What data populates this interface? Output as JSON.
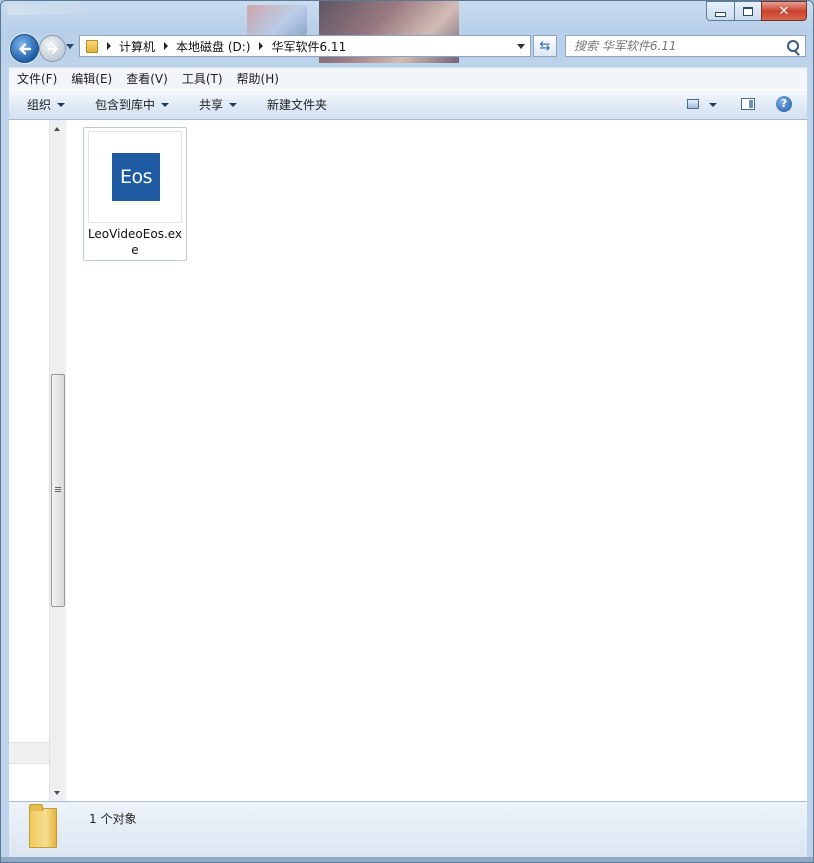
{
  "window": {
    "controls": {
      "minimize": "minimize",
      "maximize": "maximize",
      "close": "close"
    }
  },
  "navigation": {
    "breadcrumb": [
      "计算机",
      "本地磁盘 (D:)",
      "华军软件6.11"
    ],
    "search_placeholder": "搜索 华军软件6.11"
  },
  "menubar": {
    "items": [
      "文件(F)",
      "编辑(E)",
      "查看(V)",
      "工具(T)",
      "帮助(H)"
    ]
  },
  "toolbar": {
    "organize": "组织",
    "include_in_library": "包含到库中",
    "share": "共享",
    "new_folder": "新建文件夹",
    "help_glyph": "?"
  },
  "files": [
    {
      "name": "LeoVideoEos.exe",
      "icon_text": "Eos",
      "icon_color": "#1e5ba3"
    }
  ],
  "status": {
    "item_count": "1 个对象"
  },
  "colors": {
    "accent": "#1e5ba3",
    "chrome": "#bcd3ea",
    "close_button": "#c9432e"
  }
}
